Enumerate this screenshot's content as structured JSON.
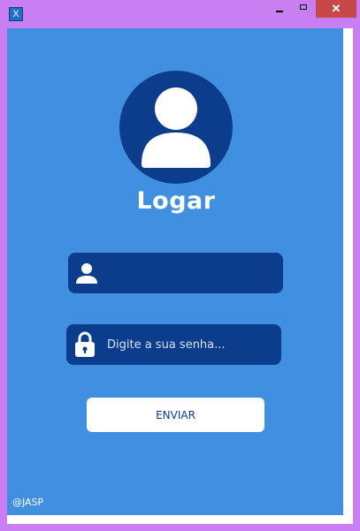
{
  "window": {
    "icon_glyph": "X",
    "controls": {
      "minimize": "minimize-icon",
      "maximize": "maximize-icon",
      "close": "✕"
    }
  },
  "login": {
    "avatar_icon": "user-avatar-icon",
    "title": "Logar",
    "username": {
      "icon": "user-icon",
      "value": "",
      "placeholder": ""
    },
    "password": {
      "icon": "lock-icon",
      "value": "",
      "placeholder": "Digite a sua senha..."
    },
    "submit_label": "ENVIAR"
  },
  "footer": {
    "credit": "@JASP"
  },
  "colors": {
    "titlebar": "#c97ef2",
    "background": "#418fe1",
    "field": "#0c3d8c",
    "close_button": "#c74848",
    "button": "#ffffff"
  }
}
